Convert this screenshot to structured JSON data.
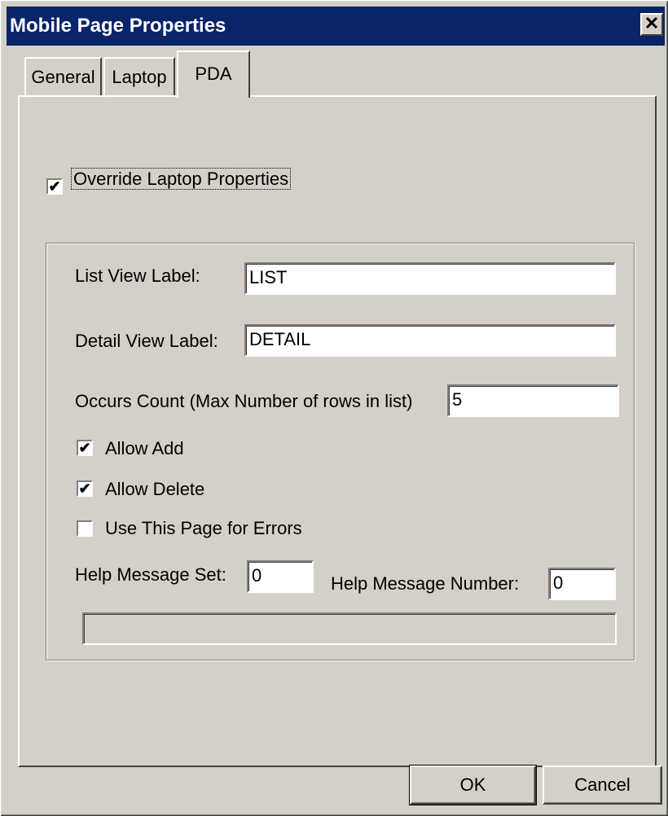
{
  "window": {
    "title": "Mobile Page Properties",
    "close_label": "✕"
  },
  "tabs": [
    {
      "label": "General",
      "active": false
    },
    {
      "label": "Laptop",
      "active": false
    },
    {
      "label": "PDA",
      "active": true
    }
  ],
  "override": {
    "label": "Override Laptop Properties",
    "checked": true,
    "mark": "✔"
  },
  "fields": {
    "list_view": {
      "label": "List View Label:",
      "value": "LIST"
    },
    "detail_view": {
      "label": "Detail View Label:",
      "value": "DETAIL"
    },
    "occurs_count": {
      "label": "Occurs Count (Max Number of rows in list)",
      "value": "5"
    },
    "help_set": {
      "label": "Help Message Set:",
      "value": "0"
    },
    "help_number": {
      "label": "Help Message Number:",
      "value": "0"
    }
  },
  "options": {
    "allow_add": {
      "label": "Allow Add",
      "checked": true,
      "mark": "✔"
    },
    "allow_delete": {
      "label": "Allow Delete",
      "checked": true,
      "mark": "✔"
    },
    "use_for_errors": {
      "label": "Use This Page for Errors",
      "checked": false,
      "mark": ""
    }
  },
  "buttons": {
    "ok": "OK",
    "cancel": "Cancel"
  }
}
